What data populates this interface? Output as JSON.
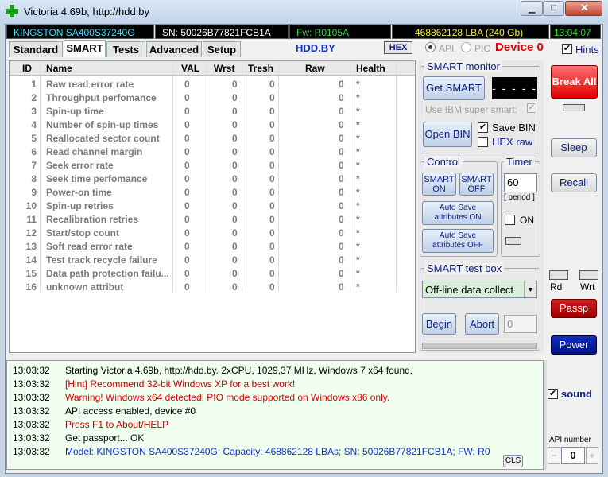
{
  "window": {
    "title": "Victoria 4.69b, http://hdd.by"
  },
  "infobar": {
    "model": "KINGSTON SA400S37240G",
    "serial": "SN: 50026B77821FCB1A",
    "firmware": "Fw: R0105A",
    "lba": "468862128 LBA (240 Gb)",
    "time": "13:04:07"
  },
  "tabs": {
    "standard": "Standard",
    "smart": "SMART",
    "tests": "Tests",
    "advanced": "Advanced",
    "setup": "Setup"
  },
  "toolbar": {
    "hddby": "HDD.BY",
    "hex": "HEX",
    "api": "API",
    "pio": "PIO",
    "device": "Device 0",
    "hints": "Hints",
    "hints_checked": true
  },
  "table": {
    "headers": {
      "id": "ID",
      "name": "Name",
      "val": "VAL",
      "wrst": "Wrst",
      "tresh": "Tresh",
      "raw": "Raw",
      "health": "Health"
    },
    "rows": [
      {
        "id": "1",
        "name": "Raw read error rate",
        "val": "0",
        "wrst": "0",
        "tresh": "0",
        "raw": "0",
        "health": "*"
      },
      {
        "id": "2",
        "name": "Throughput perfomance",
        "val": "0",
        "wrst": "0",
        "tresh": "0",
        "raw": "0",
        "health": "*"
      },
      {
        "id": "3",
        "name": "Spin-up time",
        "val": "0",
        "wrst": "0",
        "tresh": "0",
        "raw": "0",
        "health": "*"
      },
      {
        "id": "4",
        "name": "Number of spin-up times",
        "val": "0",
        "wrst": "0",
        "tresh": "0",
        "raw": "0",
        "health": "*"
      },
      {
        "id": "5",
        "name": "Reallocated sector count",
        "val": "0",
        "wrst": "0",
        "tresh": "0",
        "raw": "0",
        "health": "*"
      },
      {
        "id": "6",
        "name": "Read channel margin",
        "val": "0",
        "wrst": "0",
        "tresh": "0",
        "raw": "0",
        "health": "*"
      },
      {
        "id": "7",
        "name": "Seek error rate",
        "val": "0",
        "wrst": "0",
        "tresh": "0",
        "raw": "0",
        "health": "*"
      },
      {
        "id": "8",
        "name": "Seek time perfomance",
        "val": "0",
        "wrst": "0",
        "tresh": "0",
        "raw": "0",
        "health": "*"
      },
      {
        "id": "9",
        "name": "Power-on time",
        "val": "0",
        "wrst": "0",
        "tresh": "0",
        "raw": "0",
        "health": "*"
      },
      {
        "id": "10",
        "name": "Spin-up retries",
        "val": "0",
        "wrst": "0",
        "tresh": "0",
        "raw": "0",
        "health": "*"
      },
      {
        "id": "11",
        "name": "Recalibration retries",
        "val": "0",
        "wrst": "0",
        "tresh": "0",
        "raw": "0",
        "health": "*"
      },
      {
        "id": "12",
        "name": "Start/stop count",
        "val": "0",
        "wrst": "0",
        "tresh": "0",
        "raw": "0",
        "health": "*"
      },
      {
        "id": "13",
        "name": "Soft read error rate",
        "val": "0",
        "wrst": "0",
        "tresh": "0",
        "raw": "0",
        "health": "*"
      },
      {
        "id": "14",
        "name": "Test track recycle failure",
        "val": "0",
        "wrst": "0",
        "tresh": "0",
        "raw": "0",
        "health": "*"
      },
      {
        "id": "15",
        "name": "Data path protection failu...",
        "val": "0",
        "wrst": "0",
        "tresh": "0",
        "raw": "0",
        "health": "*"
      },
      {
        "id": "16",
        "name": "unknown attribut",
        "val": "0",
        "wrst": "0",
        "tresh": "0",
        "raw": "0",
        "health": "*"
      }
    ]
  },
  "smart_monitor": {
    "title": "SMART monitor",
    "get_smart": "Get SMART",
    "display": "- - - - -",
    "ibm": "Use IBM super smart:",
    "open_bin": "Open BIN",
    "save_bin": "Save BIN",
    "hex_raw": "HEX raw"
  },
  "control": {
    "title": "Control",
    "smart_on": "SMART ON",
    "smart_off": "SMART OFF",
    "autosave_on": "Auto Save attributes ON",
    "autosave_off": "Auto Save attributes OFF"
  },
  "timer": {
    "title": "Timer",
    "value": "60",
    "period": "[ period ]",
    "on": "ON"
  },
  "test_box": {
    "title": "SMART test box",
    "selected": "Off-line data collect",
    "begin": "Begin",
    "abort": "Abort",
    "count": "0"
  },
  "side": {
    "break_all": "Break All",
    "sleep": "Sleep",
    "recall": "Recall",
    "rd": "Rd",
    "wrt": "Wrt",
    "passp": "Passp",
    "power": "Power",
    "sound": "sound",
    "api_number_label": "API number",
    "api_number": "0",
    "cls": "CLS"
  },
  "log": [
    {
      "time": "13:03:32",
      "msg": "Starting Victoria 4.69b, http://hdd.by. 2xCPU, 1029,37 MHz, Windows 7 x64 found.",
      "color": "#000000"
    },
    {
      "time": "13:03:32",
      "msg": "[Hint] Recommend 32-bit Windows XP for a best work!",
      "color": "#c00000"
    },
    {
      "time": "13:03:32",
      "msg": "Warning! Windows x64 detected! PIO mode supported on Windows x86 only.",
      "color": "#e00000"
    },
    {
      "time": "13:03:32",
      "msg": "API access enabled, device #0",
      "color": "#000000"
    },
    {
      "time": "13:03:32",
      "msg": "Press F1 to About/HELP",
      "color": "#c00000"
    },
    {
      "time": "13:03:32",
      "msg": "Get passport... OK",
      "color": "#000000"
    },
    {
      "time": "13:03:32",
      "msg": "Model: KINGSTON SA400S37240G; Capacity: 468862128 LBAs; SN: 50026B77821FCB1A; FW: R0",
      "color": "#1030c8"
    }
  ]
}
